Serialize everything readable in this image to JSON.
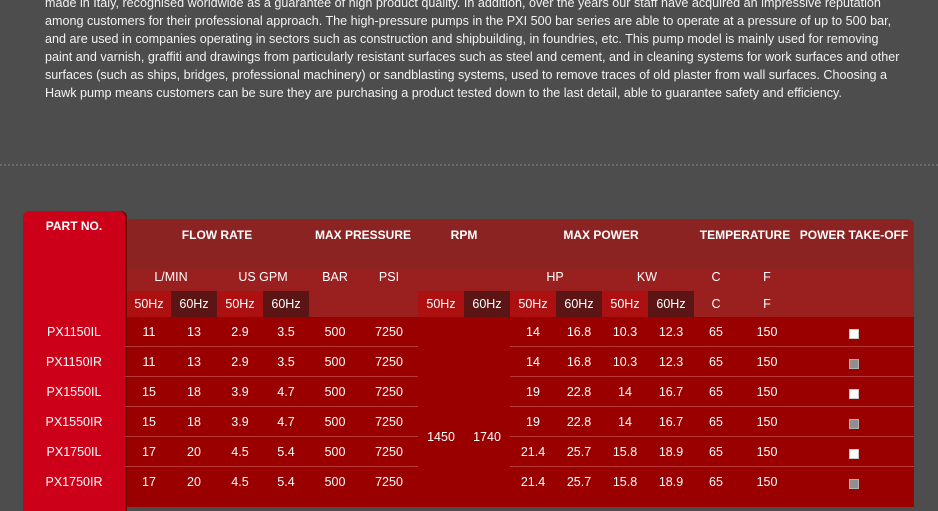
{
  "intro": {
    "paragraph": "made in Italy, recognised worldwide as a guarantee of high product quality. In addition, over the years our staff have acquired an impressive reputation among customers for their professional approach. The high-pressure pumps in the PXI 500 bar series are able to operate at a pressure of up to 500 bar, and are used in companies operating in sectors such as construction and shipbuilding, in foundries, etc. This pump model is mainly used for removing paint and varnish, graffiti and drawings from particularly resistant surfaces such as steel and cement, and in cleaning systems for work surfaces and other surfaces (such as ships, bridges, professional machinery) or sandblasting systems, used to remove traces of old plaster from wall surfaces. Choosing a Hawk pump means customers can be sure they are purchasing a product tested down to the last detail, able to guarantee safety and efficiency."
  },
  "table": {
    "headers": {
      "part_no": "PART NO.",
      "flow_rate": "FLOW RATE",
      "max_pressure": "MAX PRESSURE",
      "rpm": "RPM",
      "max_power": "MAX POWER",
      "temperature": "TEMPERATURE",
      "power_take_off": "POWER TAKE-OFF"
    },
    "subheaders": {
      "lmin": "L/MIN",
      "usgpm": "US GPM",
      "bar": "BAR",
      "psi": "PSI",
      "hp": "HP",
      "kw": "KW",
      "c": "C",
      "f": "F"
    },
    "freq": {
      "hz50": "50Hz",
      "hz60": "60Hz",
      "c": "C",
      "f": "F"
    },
    "rpm_values": {
      "hz50": "1450",
      "hz60": "1740"
    },
    "rows": [
      {
        "part": "PX1150IL",
        "l50": "11",
        "l60": "13",
        "g50": "2.9",
        "g60": "3.5",
        "bar": "500",
        "psi": "7250",
        "hp50": "14",
        "hp60": "16.8",
        "kw50": "10.3",
        "kw60": "12.3",
        "c": "65",
        "f": "150",
        "pto": "empty"
      },
      {
        "part": "PX1150IR",
        "l50": "11",
        "l60": "13",
        "g50": "2.9",
        "g60": "3.5",
        "bar": "500",
        "psi": "7250",
        "hp50": "14",
        "hp60": "16.8",
        "kw50": "10.3",
        "kw60": "12.3",
        "c": "65",
        "f": "150",
        "pto": "filled"
      },
      {
        "part": "PX1550IL",
        "l50": "15",
        "l60": "18",
        "g50": "3.9",
        "g60": "4.7",
        "bar": "500",
        "psi": "7250",
        "hp50": "19",
        "hp60": "22.8",
        "kw50": "14",
        "kw60": "16.7",
        "c": "65",
        "f": "150",
        "pto": "empty"
      },
      {
        "part": "PX1550IR",
        "l50": "15",
        "l60": "18",
        "g50": "3.9",
        "g60": "4.7",
        "bar": "500",
        "psi": "7250",
        "hp50": "19",
        "hp60": "22.8",
        "kw50": "14",
        "kw60": "16.7",
        "c": "65",
        "f": "150",
        "pto": "filled"
      },
      {
        "part": "PX1750IL",
        "l50": "17",
        "l60": "20",
        "g50": "4.5",
        "g60": "5.4",
        "bar": "500",
        "psi": "7250",
        "hp50": "21.4",
        "hp60": "25.7",
        "kw50": "15.8",
        "kw60": "18.9",
        "c": "65",
        "f": "150",
        "pto": "empty"
      },
      {
        "part": "PX1750IR",
        "l50": "17",
        "l60": "20",
        "g50": "4.5",
        "g60": "5.4",
        "bar": "500",
        "psi": "7250",
        "hp50": "21.4",
        "hp60": "25.7",
        "kw50": "15.8",
        "kw60": "18.9",
        "c": "65",
        "f": "150",
        "pto": "filled"
      }
    ]
  },
  "colors": {
    "page_bg": "#4d4d4d",
    "part_tab": "#cc0018",
    "header": "#8c2323",
    "body": "#9a0000"
  }
}
